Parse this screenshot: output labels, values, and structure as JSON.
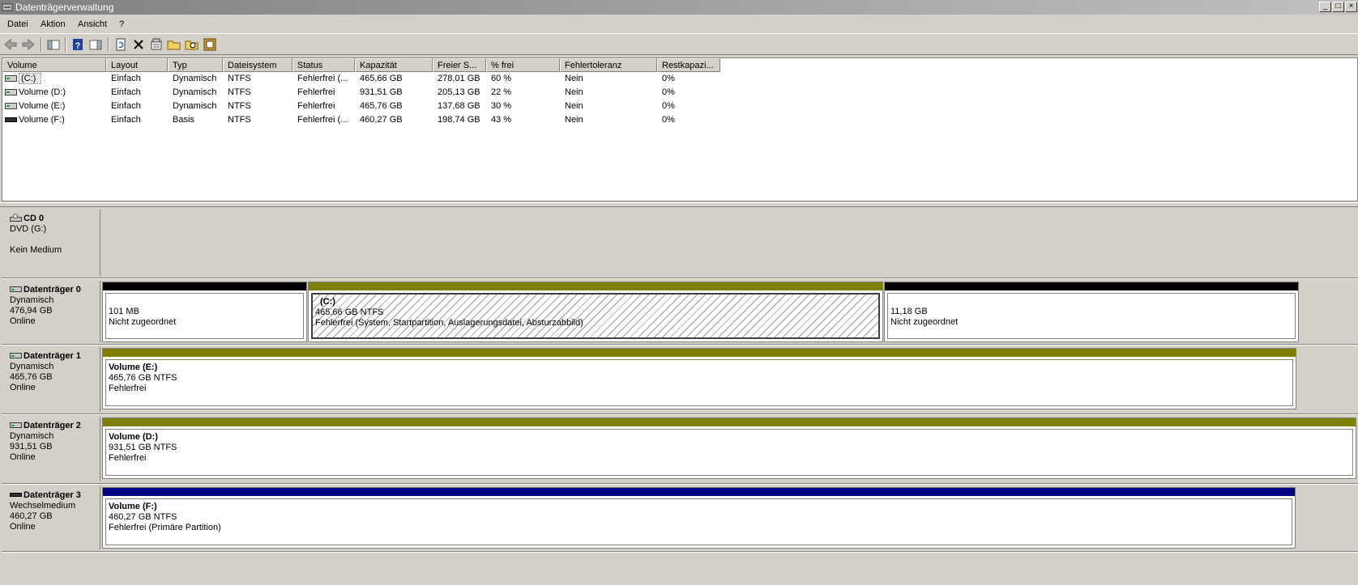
{
  "window": {
    "title": "Datenträgerverwaltung",
    "minimize": "_",
    "maximize": "□",
    "close": "×"
  },
  "menu": [
    "Datei",
    "Aktion",
    "Ansicht",
    "?"
  ],
  "toolbar": {
    "icons": [
      "back-icon",
      "forward-icon",
      "console-tree-icon",
      "help-icon",
      "show-hide-icon",
      "refresh-icon",
      "delete-icon",
      "properties-icon",
      "open-icon",
      "explore-icon",
      "export-icon"
    ]
  },
  "list": {
    "columns": [
      "Volume",
      "Layout",
      "Typ",
      "Dateisystem",
      "Status",
      "Kapazität",
      "Freier S...",
      "% frei",
      "Fehlertoleranz",
      "Restkapazi..."
    ],
    "rows": [
      [
        "(C:)",
        "Einfach",
        "Dynamisch",
        "NTFS",
        "Fehlerfrei (...",
        "465,66 GB",
        "278,01 GB",
        "60 %",
        "Nein",
        "0%"
      ],
      [
        "Volume (D:)",
        "Einfach",
        "Dynamisch",
        "NTFS",
        "Fehlerfrei",
        "931,51 GB",
        "205,13 GB",
        "22 %",
        "Nein",
        "0%"
      ],
      [
        "Volume (E:)",
        "Einfach",
        "Dynamisch",
        "NTFS",
        "Fehlerfrei",
        "465,76 GB",
        "137,68 GB",
        "30 %",
        "Nein",
        "0%"
      ],
      [
        "Volume (F:)",
        "Einfach",
        "Basis",
        "NTFS",
        "Fehlerfrei (...",
        "460,27 GB",
        "198,74 GB",
        "43 %",
        "Nein",
        "0%"
      ]
    ]
  },
  "disks": [
    {
      "name": "CD 0",
      "lines": [
        "DVD (G:)",
        "",
        "Kein Medium"
      ],
      "partitions": []
    },
    {
      "name": "Datenträger 0",
      "lines": [
        "Dynamisch",
        "476,94 GB",
        "Online"
      ],
      "partitions": [
        {
          "name": "",
          "size": "101 MB",
          "status": "Nicht zugeordnet",
          "color": "#000000",
          "hatched": false
        },
        {
          "name": "(C:)",
          "size": "465,66 GB NTFS",
          "status": "Fehlerfrei (System, Startpartition, Auslagerungsdatei, Absturzabbild)",
          "color": "#808000",
          "hatched": true
        },
        {
          "name": "",
          "size": "11,18 GB",
          "status": "Nicht zugeordnet",
          "color": "#000000",
          "hatched": false
        }
      ]
    },
    {
      "name": "Datenträger 1",
      "lines": [
        "Dynamisch",
        "465,76 GB",
        "Online"
      ],
      "partitions": [
        {
          "name": "Volume  (E:)",
          "size": "465,76 GB NTFS",
          "status": "Fehlerfrei",
          "color": "#808000",
          "hatched": false
        }
      ]
    },
    {
      "name": "Datenträger 2",
      "lines": [
        "Dynamisch",
        "931,51 GB",
        "Online"
      ],
      "partitions": [
        {
          "name": "Volume  (D:)",
          "size": "931,51 GB NTFS",
          "status": "Fehlerfrei",
          "color": "#808000",
          "hatched": false
        }
      ]
    },
    {
      "name": "Datenträger 3",
      "lines": [
        "Wechselmedium",
        "460,27 GB",
        "Online"
      ],
      "partitions": [
        {
          "name": "Volume  (F:)",
          "size": "460,27 GB NTFS",
          "status": "Fehlerfrei (Primäre Partition)",
          "color": "#000080",
          "hatched": false
        }
      ]
    }
  ]
}
